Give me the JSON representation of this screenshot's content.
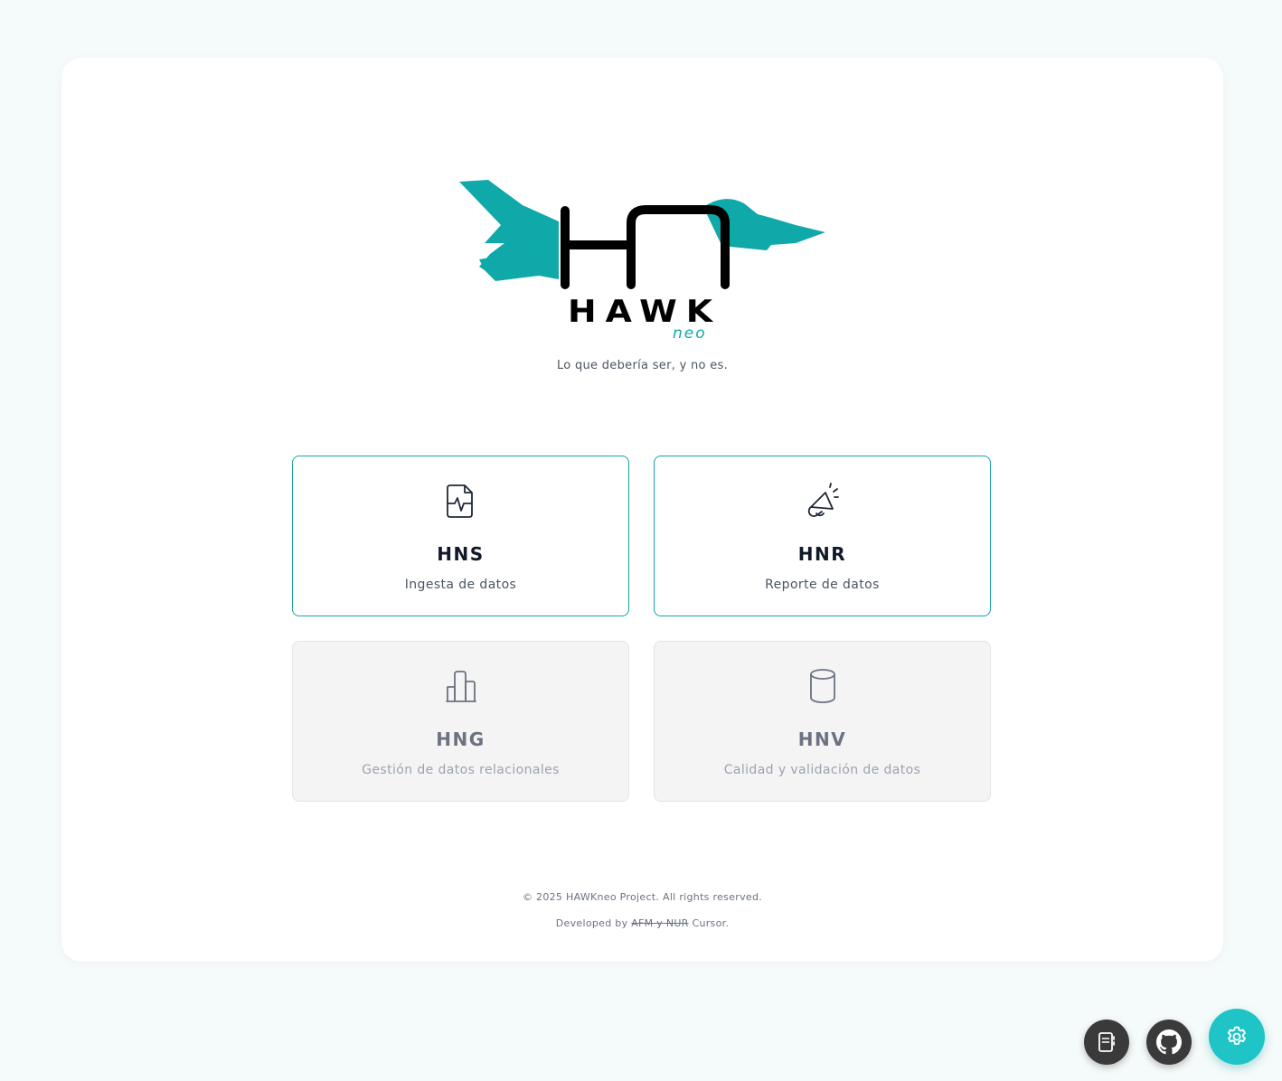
{
  "brand": {
    "logo_monogram": "HN",
    "logo_wordmark": "HAWK",
    "logo_suffix": "neo",
    "tagline": "Lo que debería ser, y no es."
  },
  "modules": [
    {
      "code": "HNS",
      "description": "Ingesta de datos",
      "icon": "file-activity-icon",
      "enabled": true
    },
    {
      "code": "HNR",
      "description": "Reporte de datos",
      "icon": "megaphone-icon",
      "enabled": true
    },
    {
      "code": "HNG",
      "description": "Gestión de datos relacionales",
      "icon": "bar-chart-icon",
      "enabled": false
    },
    {
      "code": "HNV",
      "description": "Calidad y validación de datos",
      "icon": "database-icon",
      "enabled": false
    }
  ],
  "footer": {
    "copyright": "© 2025 HAWKneo Project. All rights reserved.",
    "developed_prefix": "Developed by",
    "developed_struck": "AFM y NUR",
    "developed_suffix": "Cursor."
  },
  "floating_buttons": [
    {
      "name": "docs-button",
      "icon": "notebook-icon"
    },
    {
      "name": "github-button",
      "icon": "github-icon"
    },
    {
      "name": "settings-button",
      "icon": "gear-icon"
    }
  ],
  "colors": {
    "accent": "#14a5a5",
    "logo_teal": "#0fa9a9",
    "fab_teal": "#1fc4c6",
    "fab_dark": "#3a3a3a",
    "background": "#f5fafa"
  }
}
